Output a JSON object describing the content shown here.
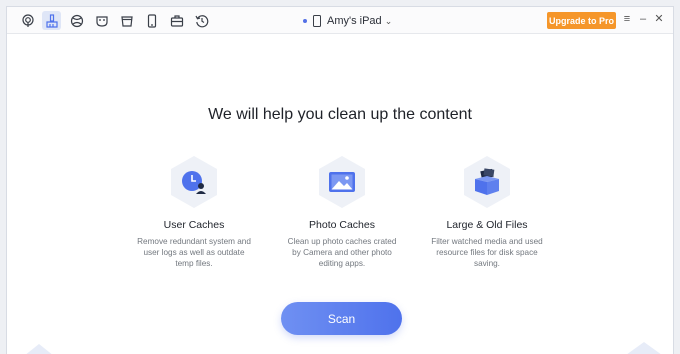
{
  "toolbar": {
    "icons": [
      "airplay-icon",
      "cleaner-icon",
      "browser-icon",
      "mask-icon",
      "cup-icon",
      "phone-icon",
      "toolbox-icon",
      "history-icon"
    ],
    "active_index": 1
  },
  "device": {
    "name": "Amy's iPad",
    "status_color": "#5470e6"
  },
  "upgrade": {
    "label": "Upgrade to Pro",
    "color": "#f5962a"
  },
  "window_controls": {
    "menu": "≡",
    "minimize": "–",
    "close": "✕"
  },
  "main": {
    "heading": "We will help you clean up the content",
    "features": [
      {
        "icon": "user-caches-icon",
        "title": "User Caches",
        "description": "Remove redundant system and user logs as well as outdate temp files."
      },
      {
        "icon": "photo-caches-icon",
        "title": "Photo Caches",
        "description": "Clean up photo caches crated by Camera and other photo editing apps."
      },
      {
        "icon": "large-files-icon",
        "title": "Large & Old Files",
        "description": "Filter watched media and used resource files for disk space saving."
      }
    ],
    "scan_label": "Scan",
    "accent": "#4f72ec"
  }
}
